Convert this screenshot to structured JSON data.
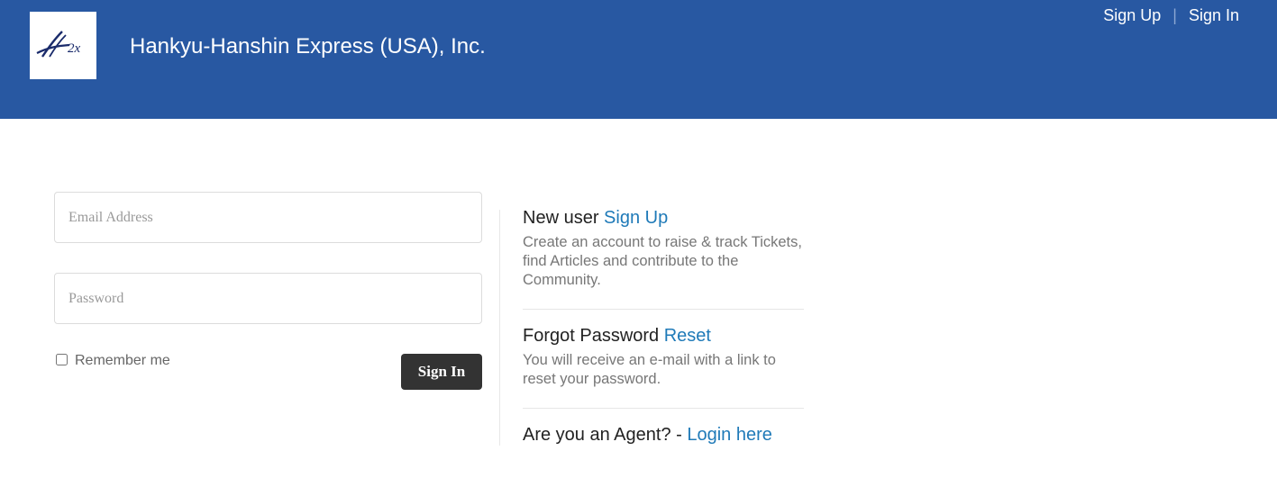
{
  "header": {
    "logo_alt": "2x",
    "title": "Hankyu-Hanshin Express (USA), Inc.",
    "nav": {
      "signup": "Sign Up",
      "separator": "|",
      "signin": "Sign In"
    },
    "colors": {
      "background": "#2858a2",
      "text": "#ffffff"
    }
  },
  "login_form": {
    "email_placeholder": "Email Address",
    "password_placeholder": "Password",
    "remember_label": "Remember me",
    "remember_checked": false,
    "submit_label": "Sign In"
  },
  "info": {
    "new_user": {
      "heading": "New user",
      "link": "Sign Up",
      "description": "Create an account to raise & track Tickets, find Articles and contribute to the Community."
    },
    "forgot_password": {
      "heading": "Forgot Password",
      "link": "Reset",
      "description": "You will receive an e-mail with a link to reset your password."
    },
    "agent": {
      "heading": "Are you an Agent? -",
      "link": "Login here"
    }
  },
  "colors": {
    "link": "#1f7ab8",
    "button": "#333333"
  }
}
